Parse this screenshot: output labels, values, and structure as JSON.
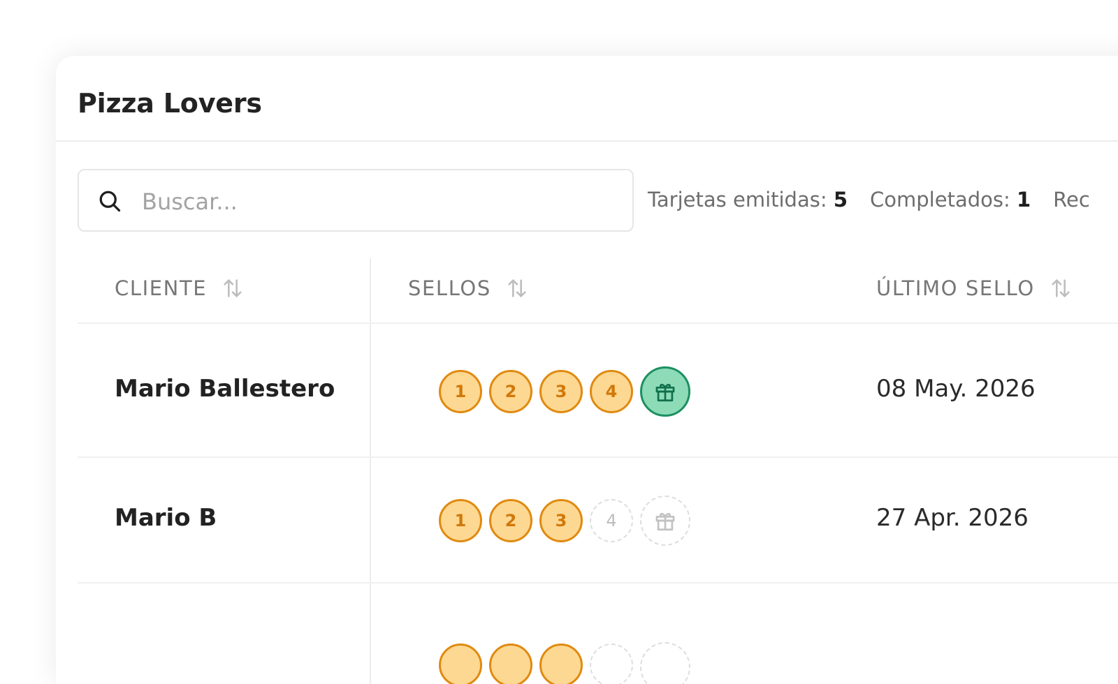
{
  "card": {
    "title": "Pizza Lovers"
  },
  "search": {
    "placeholder": "Buscar...",
    "value": ""
  },
  "stats": [
    {
      "label": "Tarjetas emitidas:",
      "value": "5"
    },
    {
      "label": "Completados:",
      "value": "1"
    },
    {
      "label": "Rec",
      "value": ""
    }
  ],
  "table": {
    "columns": [
      {
        "label": "CLIENTE"
      },
      {
        "label": "SELLOS"
      },
      {
        "label": "ÚLTIMO SELLO"
      }
    ],
    "rows": [
      {
        "name": "Mario Ballestero",
        "stamps": [
          {
            "label": "1",
            "filled": true
          },
          {
            "label": "2",
            "filled": true
          },
          {
            "label": "3",
            "filled": true
          },
          {
            "label": "4",
            "filled": true
          }
        ],
        "reward_unlocked": true,
        "last_stamp": "08 May. 2026"
      },
      {
        "name": "Mario B",
        "stamps": [
          {
            "label": "1",
            "filled": true
          },
          {
            "label": "2",
            "filled": true
          },
          {
            "label": "3",
            "filled": true
          },
          {
            "label": "4",
            "filled": false
          }
        ],
        "reward_unlocked": false,
        "last_stamp": "27 Apr. 2026"
      }
    ]
  },
  "icons": {
    "search": "search-icon",
    "sort": "sort-arrows-icon",
    "reward": "gift-icon"
  },
  "colors": {
    "stamp_fill": "#fdd892",
    "stamp_border": "#e08a10",
    "stamp_text": "#d0780a",
    "reward_fill": "#8ddbb7",
    "reward_border": "#1d8f62",
    "empty_border": "#dddddd"
  }
}
